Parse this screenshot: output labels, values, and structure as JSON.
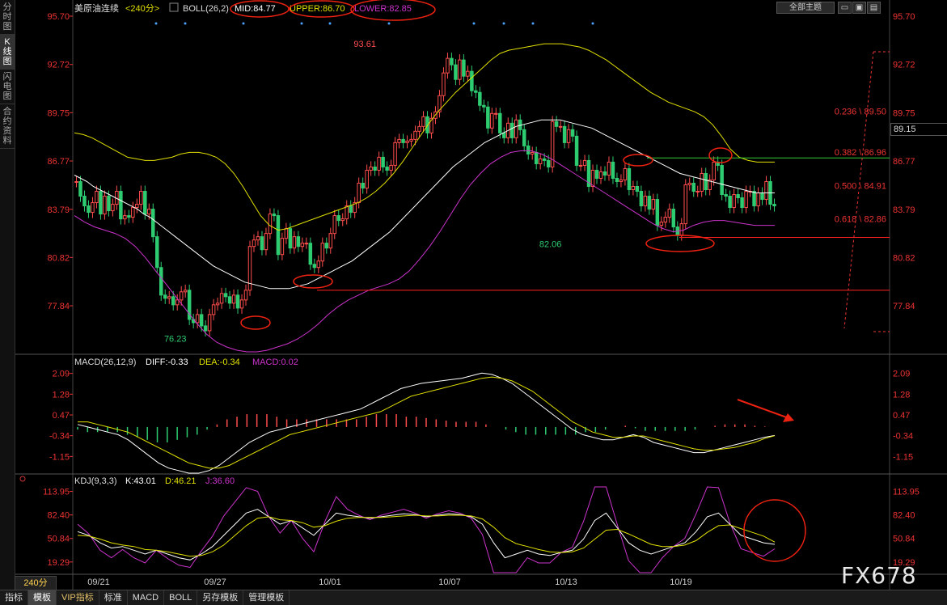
{
  "side_tabs": [
    "分时图",
    "K线图",
    "闪电图",
    "合约资料"
  ],
  "side_active": 1,
  "header": {
    "symbol": "美原油连续",
    "period": "<240分>",
    "boll_label": "BOLL(26,2)",
    "mid_label": "MID:84.77",
    "upper_label": "UPPER:86.70",
    "lower_label": "LOWER:82.85"
  },
  "theme_button": "全部主题",
  "price_tag": "89.15",
  "macd_header": {
    "label": "MACD(26,12,9)",
    "diff": "DIFF:-0.33",
    "dea": "DEA:-0.34",
    "macd": "MACD:0.02"
  },
  "kdj_header": {
    "label": "KDJ(9,3,3)",
    "k": "K:43.01",
    "d": "D:46.21",
    "j": "J:36.60"
  },
  "timeframe": "240分",
  "bottom_tabs": [
    "指标",
    "模板",
    "VIP指标",
    "标准",
    "MACD",
    "BOLL",
    "另存模板",
    "管理模板"
  ],
  "bottom_active": 1,
  "watermark": "FX678",
  "colors": {
    "up": "#ff4d4d",
    "down": "#2ecc71",
    "mid": "#ffffff",
    "upper": "#e0e000",
    "lower": "#cc33cc",
    "dea": "#e0e000",
    "red_line": "#ff2020",
    "green_line": "#33cc33"
  },
  "chart_data": [
    {
      "type": "candlestick",
      "title": "美原油连续",
      "y_ticks": [
        "95.70",
        "92.72",
        "89.75",
        "86.77",
        "83.79",
        "80.82",
        "77.84"
      ],
      "x_ticks": [
        "09/21",
        "09/27",
        "10/01",
        "10/07",
        "10/13",
        "10/19"
      ],
      "ylim": [
        75.0,
        95.7
      ],
      "annotations": [
        {
          "text": "93.61",
          "x": 72,
          "y": 93.61,
          "color": "#ff4d4d"
        },
        {
          "text": "76.23",
          "x": 25,
          "y": 76.23,
          "color": "#2ecc71"
        },
        {
          "text": "82.06",
          "x": 118,
          "y": 82.06,
          "color": "#2ecc71"
        }
      ],
      "fib_levels": [
        {
          "label": "0.236 \\ 89.50",
          "value": 89.5
        },
        {
          "label": "0.382 \\ 86.96",
          "value": 86.96
        },
        {
          "label": "0.500 \\ 84.91",
          "value": 84.91
        },
        {
          "label": "0.618 \\ 82.86",
          "value": 82.86
        }
      ],
      "hlines": [
        {
          "value": 86.96,
          "color": "green"
        },
        {
          "value": 82.06,
          "color": "red"
        },
        {
          "value": 78.8,
          "color": "red"
        }
      ],
      "closes": [
        85.5,
        84.6,
        84.0,
        83.6,
        84.2,
        84.9,
        83.5,
        84.6,
        83.7,
        84.1,
        84.9,
        83.2,
        83.4,
        83.3,
        83.9,
        84.1,
        84.9,
        83.5,
        83.8,
        82.1,
        80.2,
        78.5,
        78.3,
        78.4,
        77.9,
        78.2,
        78.7,
        78.8,
        77.0,
        76.8,
        77.3,
        76.6,
        76.3,
        77.3,
        77.9,
        78.0,
        78.6,
        78.4,
        78.0,
        78.5,
        77.7,
        78.2,
        78.8,
        81.5,
        81.9,
        82.1,
        81.3,
        82.3,
        83.5,
        83.4,
        81.0,
        82.0,
        82.6,
        81.4,
        82.1,
        81.5,
        81.7,
        81.7,
        80.4,
        80.2,
        80.6,
        81.7,
        81.4,
        82.3,
        83.4,
        83.1,
        83.2,
        84.0,
        83.6,
        84.2,
        85.4,
        85.1,
        86.2,
        86.4,
        86.2,
        87.0,
        86.4,
        86.2,
        86.5,
        87.9,
        88.1,
        87.9,
        88.0,
        88.1,
        88.6,
        88.9,
        89.5,
        88.5,
        89.4,
        89.8,
        90.8,
        92.2,
        93.1,
        92.7,
        91.8,
        93.0,
        92.0,
        92.3,
        91.1,
        91.0,
        90.2,
        90.1,
        88.8,
        89.7,
        89.7,
        88.5,
        88.2,
        89.1,
        88.2,
        89.3,
        88.7,
        87.7,
        87.2,
        87.3,
        86.6,
        86.9,
        86.8,
        86.4,
        89.2,
        88.9,
        88.9,
        87.9,
        88.7,
        88.3,
        86.5,
        86.5,
        86.8,
        85.2,
        86.2,
        85.7,
        86.1,
        85.9,
        86.7,
        85.7,
        85.5,
        85.6,
        86.3,
        85.0,
        85.2,
        84.9,
        84.0,
        84.6,
        83.8,
        84.4,
        82.8,
        83.0,
        83.3,
        83.8,
        82.7,
        82.2,
        82.9,
        85.3,
        85.4,
        84.9,
        84.9,
        86.0,
        85.0,
        85.6,
        86.7,
        86.5,
        84.7,
        84.6,
        83.9,
        84.7,
        84.5,
        83.9,
        84.9,
        84.9,
        84.0,
        84.8,
        84.4,
        85.5,
        84.1,
        84.0
      ],
      "mid": [
        85.9,
        85.7,
        85.5,
        85.2,
        85.0,
        84.8,
        84.6,
        84.4,
        84.2,
        84.0,
        83.8,
        83.5,
        83.3,
        83.0,
        82.7,
        82.4,
        82.1,
        81.8,
        81.5,
        81.2,
        80.9,
        80.6,
        80.3,
        80.1,
        79.9,
        79.7,
        79.5,
        79.3,
        79.2,
        79.1,
        79.0,
        78.9,
        78.9,
        78.9,
        78.9,
        79.0,
        79.1,
        79.2,
        79.4,
        79.6,
        79.8,
        80.0,
        80.2,
        80.4,
        80.6,
        80.9,
        81.2,
        81.5,
        81.8,
        82.1,
        82.4,
        82.8,
        83.2,
        83.6,
        84.0,
        84.4,
        84.8,
        85.2,
        85.6,
        86.0,
        86.4,
        86.7,
        87.0,
        87.3,
        87.6,
        87.9,
        88.1,
        88.3,
        88.5,
        88.7,
        88.9,
        89.0,
        89.1,
        89.2,
        89.3,
        89.3,
        89.3,
        89.3,
        89.2,
        89.1,
        89.0,
        88.9,
        88.8,
        88.6,
        88.4,
        88.2,
        88.0,
        87.8,
        87.6,
        87.4,
        87.2,
        87.0,
        86.8,
        86.6,
        86.4,
        86.2,
        86.0,
        85.9,
        85.8,
        85.7,
        85.6,
        85.5,
        85.4,
        85.3,
        85.2,
        85.1,
        85.0,
        84.9,
        84.8,
        84.8,
        84.8,
        84.8
      ],
      "upper": [
        88.5,
        88.4,
        88.2,
        87.9,
        87.6,
        87.3,
        87.0,
        86.9,
        86.8,
        86.8,
        86.9,
        87.0,
        87.2,
        87.3,
        87.3,
        87.2,
        87.0,
        86.6,
        86.0,
        85.2,
        84.3,
        83.4,
        82.8,
        82.5,
        82.6,
        82.8,
        83.0,
        83.2,
        83.4,
        83.6,
        83.8,
        84.0,
        84.2,
        84.5,
        84.9,
        85.4,
        86.0,
        86.7,
        87.5,
        88.3,
        89.1,
        89.8,
        90.4,
        91.0,
        91.5,
        92.0,
        92.5,
        93.0,
        93.4,
        93.6,
        93.7,
        93.8,
        93.9,
        94.0,
        94.0,
        94.0,
        93.9,
        93.8,
        93.6,
        93.3,
        93.0,
        92.6,
        92.2,
        91.8,
        91.4,
        91.0,
        90.7,
        90.4,
        90.2,
        90.0,
        89.8,
        89.5,
        89.0,
        88.3,
        87.5,
        87.0,
        86.8,
        86.7,
        86.7,
        86.7
      ],
      "lower": [
        83.4,
        83.0,
        82.7,
        82.5,
        82.3,
        82.0,
        81.5,
        80.8,
        80.0,
        79.2,
        78.4,
        77.6,
        76.8,
        76.1,
        75.6,
        75.3,
        75.1,
        75.0,
        75.0,
        75.1,
        75.3,
        75.5,
        75.8,
        76.2,
        76.7,
        77.3,
        77.8,
        78.2,
        78.5,
        78.8,
        79.0,
        79.2,
        79.5,
        80.0,
        80.7,
        81.5,
        82.4,
        83.4,
        84.4,
        85.3,
        86.0,
        86.6,
        87.0,
        87.3,
        87.4,
        87.4,
        87.2,
        86.9,
        86.5,
        86.1,
        85.7,
        85.3,
        84.9,
        84.5,
        84.1,
        83.7,
        83.3,
        82.9,
        82.6,
        82.4,
        82.5,
        82.8,
        83.0,
        83.1,
        83.1,
        83.0,
        82.9,
        82.8,
        82.8,
        82.8
      ]
    },
    {
      "type": "bar",
      "title": "MACD(26,12,9)",
      "y_ticks": [
        "2.09",
        "1.28",
        "0.47",
        "-0.34",
        "-1.15"
      ],
      "ylim": [
        -1.8,
        2.3
      ],
      "series": [
        {
          "name": "DIFF",
          "values": [
            0.1,
            0.0,
            -0.1,
            -0.2,
            -0.3,
            -0.5,
            -0.8,
            -1.1,
            -1.4,
            -1.6,
            -1.7,
            -1.8,
            -1.8,
            -1.7,
            -1.5,
            -1.2,
            -0.9,
            -0.6,
            -0.4,
            -0.2,
            -0.1,
            0.0,
            0.1,
            0.2,
            0.3,
            0.4,
            0.5,
            0.6,
            0.7,
            0.9,
            1.1,
            1.3,
            1.5,
            1.6,
            1.7,
            1.75,
            1.8,
            1.85,
            1.9,
            2.0,
            2.1,
            2.05,
            1.9,
            1.7,
            1.4,
            1.1,
            0.8,
            0.5,
            0.2,
            -0.1,
            -0.3,
            -0.4,
            -0.5,
            -0.5,
            -0.4,
            -0.3,
            -0.4,
            -0.6,
            -0.7,
            -0.8,
            -0.9,
            -1.0,
            -1.0,
            -0.9,
            -0.8,
            -0.7,
            -0.6,
            -0.5,
            -0.4,
            -0.33
          ]
        },
        {
          "name": "DEA",
          "values": [
            0.2,
            0.2,
            0.1,
            0.0,
            -0.1,
            -0.2,
            -0.4,
            -0.6,
            -0.8,
            -1.0,
            -1.2,
            -1.4,
            -1.5,
            -1.6,
            -1.6,
            -1.5,
            -1.3,
            -1.1,
            -0.9,
            -0.7,
            -0.5,
            -0.3,
            -0.2,
            -0.1,
            0.0,
            0.1,
            0.2,
            0.3,
            0.4,
            0.5,
            0.6,
            0.8,
            1.0,
            1.2,
            1.3,
            1.4,
            1.5,
            1.6,
            1.7,
            1.8,
            1.9,
            1.95,
            1.9,
            1.8,
            1.6,
            1.4,
            1.1,
            0.8,
            0.5,
            0.2,
            0.0,
            -0.2,
            -0.3,
            -0.4,
            -0.4,
            -0.35,
            -0.35,
            -0.45,
            -0.55,
            -0.65,
            -0.75,
            -0.85,
            -0.9,
            -0.9,
            -0.85,
            -0.8,
            -0.7,
            -0.6,
            -0.45,
            -0.34
          ]
        },
        {
          "name": "MACD",
          "values": [
            -0.1,
            -0.2,
            -0.2,
            -0.2,
            -0.2,
            -0.3,
            -0.4,
            -0.5,
            -0.6,
            -0.6,
            -0.5,
            -0.4,
            -0.3,
            -0.1,
            0.1,
            0.3,
            0.4,
            0.5,
            0.5,
            0.5,
            0.4,
            0.3,
            0.3,
            0.3,
            0.3,
            0.3,
            0.3,
            0.3,
            0.3,
            0.4,
            0.5,
            0.5,
            0.5,
            0.4,
            0.4,
            0.35,
            0.3,
            0.25,
            0.2,
            0.2,
            0.2,
            0.1,
            0.0,
            -0.1,
            -0.2,
            -0.3,
            -0.3,
            -0.3,
            -0.3,
            -0.3,
            -0.3,
            -0.2,
            -0.2,
            -0.1,
            0.0,
            0.05,
            -0.05,
            -0.15,
            -0.15,
            -0.15,
            -0.15,
            -0.15,
            -0.1,
            0.0,
            0.05,
            0.1,
            0.1,
            0.1,
            0.05,
            0.02
          ]
        }
      ]
    },
    {
      "type": "line",
      "title": "KDJ(9,3,3)",
      "y_ticks": [
        "113.95",
        "82.40",
        "50.84",
        "19.29"
      ],
      "ylim": [
        5,
        120
      ],
      "series": [
        {
          "name": "K",
          "values": [
            60,
            55,
            45,
            38,
            40,
            35,
            30,
            35,
            30,
            25,
            22,
            30,
            40,
            55,
            70,
            85,
            90,
            80,
            70,
            75,
            65,
            55,
            70,
            85,
            82,
            80,
            78,
            80,
            82,
            84,
            83,
            80,
            82,
            84,
            83,
            80,
            70,
            45,
            25,
            30,
            35,
            30,
            28,
            32,
            35,
            50,
            75,
            85,
            65,
            45,
            35,
            30,
            35,
            40,
            45,
            60,
            80,
            85,
            70,
            55,
            50,
            45,
            43
          ]
        },
        {
          "name": "D",
          "values": [
            55,
            54,
            50,
            45,
            42,
            40,
            36,
            35,
            33,
            30,
            27,
            28,
            33,
            42,
            55,
            68,
            78,
            80,
            76,
            75,
            72,
            66,
            68,
            74,
            78,
            79,
            79,
            79,
            80,
            81,
            82,
            81,
            81,
            82,
            82,
            81,
            77,
            66,
            52,
            44,
            40,
            36,
            33,
            32,
            33,
            38,
            50,
            62,
            63,
            57,
            50,
            43,
            40,
            40,
            42,
            48,
            59,
            68,
            69,
            64,
            59,
            54,
            46
          ]
        },
        {
          "name": "J",
          "values": [
            70,
            57,
            35,
            25,
            36,
            25,
            18,
            35,
            24,
            15,
            12,
            34,
            54,
            81,
            100,
            119,
            114,
            80,
            58,
            75,
            51,
            33,
            74,
            107,
            90,
            82,
            76,
            82,
            86,
            90,
            85,
            78,
            84,
            88,
            85,
            78,
            56,
            3,
            -29,
            2,
            25,
            18,
            18,
            32,
            39,
            74,
            125,
            131,
            69,
            21,
            5,
            4,
            25,
            40,
            51,
            84,
            122,
            119,
            72,
            37,
            32,
            27,
            37
          ]
        }
      ]
    }
  ]
}
